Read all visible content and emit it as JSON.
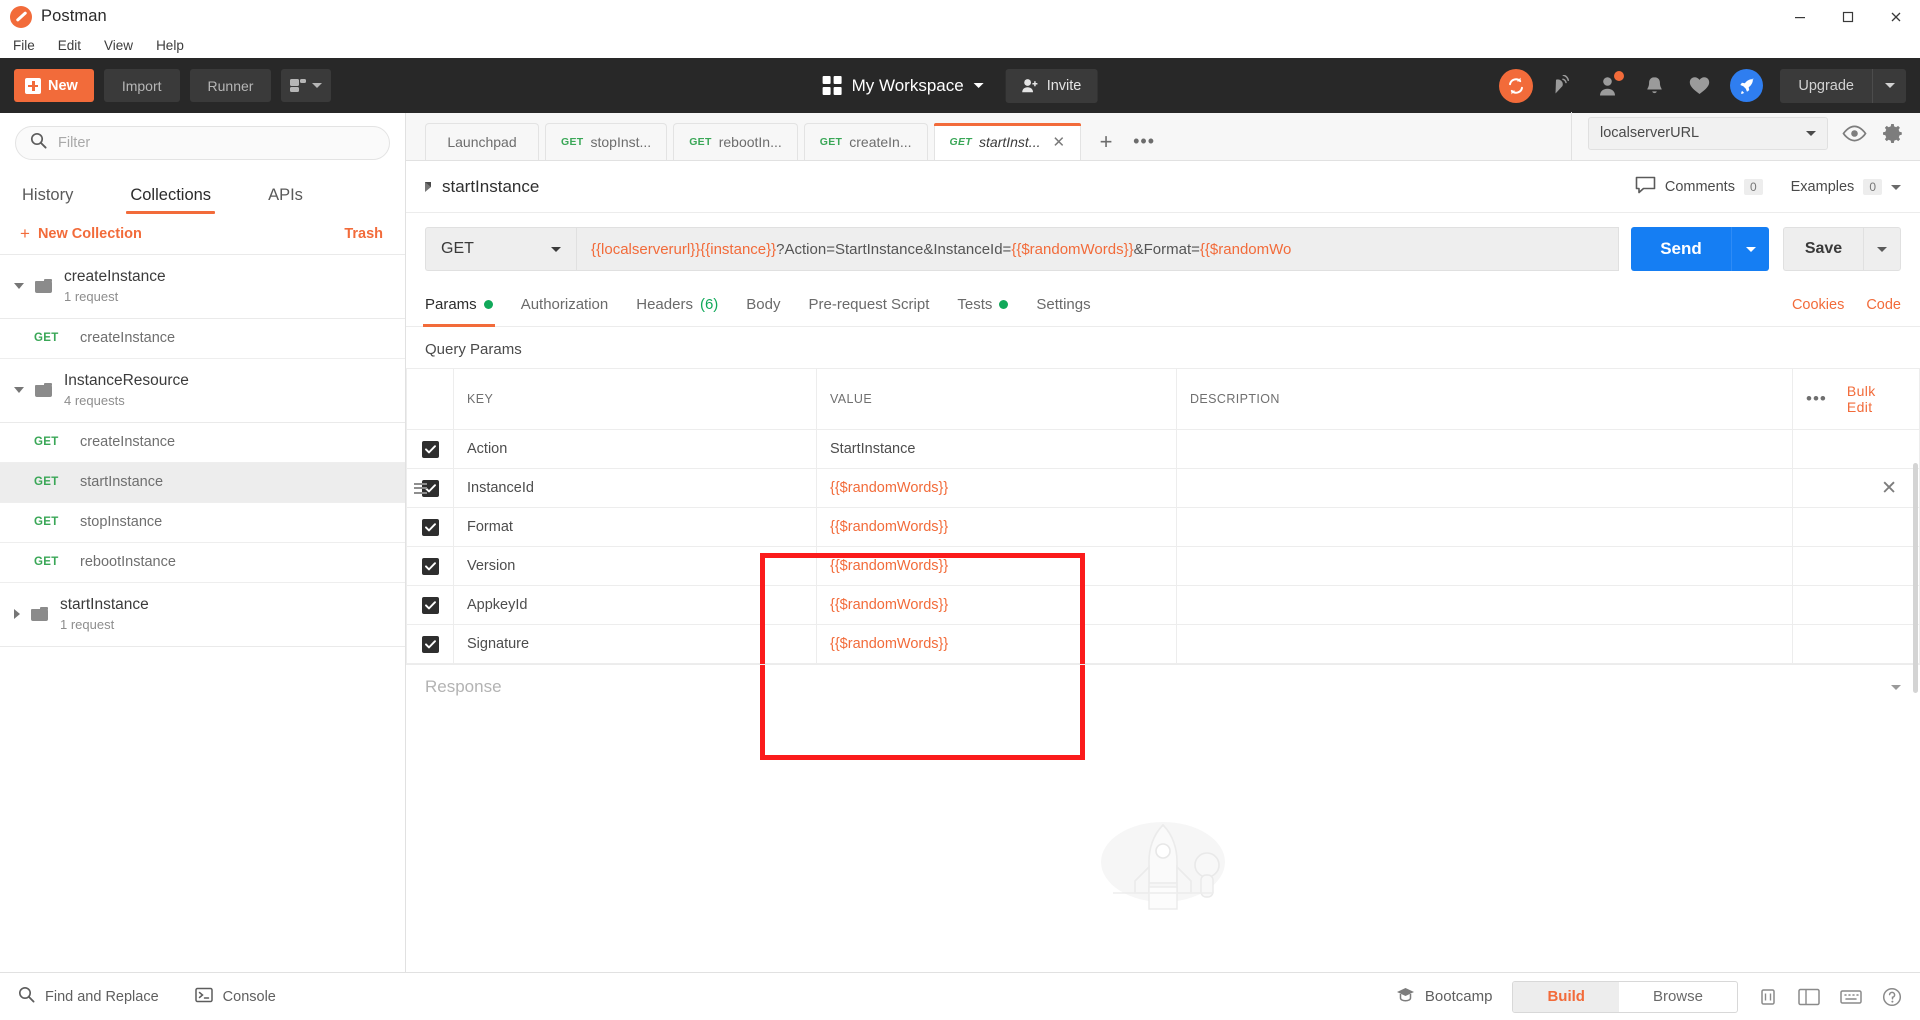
{
  "window": {
    "app_title": "Postman",
    "logo_icon": "postman-logo-icon",
    "minimize_icon": "minimize-icon",
    "maximize_icon": "maximize-icon",
    "close_icon": "close-icon"
  },
  "menubar": {
    "items": [
      "File",
      "Edit",
      "View",
      "Help"
    ]
  },
  "toolbar": {
    "new_label": "New",
    "import_label": "Import",
    "runner_label": "Runner",
    "capture_icon": "capture-requests-icon",
    "workspace_label": "My Workspace",
    "workspace_icon": "grid-icon",
    "invite_label": "Invite",
    "invite_icon": "person-add-icon",
    "icons": [
      "sync-icon",
      "satellite-icon",
      "account-icon",
      "notifications-bell-icon",
      "heart-icon",
      "rocket-icon"
    ],
    "upgrade_label": "Upgrade"
  },
  "sidebar": {
    "filter_placeholder": "Filter",
    "search_icon": "search-icon",
    "tabs": [
      {
        "label": "History",
        "active": false
      },
      {
        "label": "Collections",
        "active": true
      },
      {
        "label": "APIs",
        "active": false
      }
    ],
    "new_collection_label": "New Collection",
    "trash_label": "Trash",
    "tree": [
      {
        "type": "collection",
        "name": "createInstance",
        "sub": "1 request",
        "expanded": true
      },
      {
        "type": "request",
        "method": "GET",
        "name": "createInstance",
        "selected": false
      },
      {
        "type": "collection",
        "name": "InstanceResource",
        "sub": "4 requests",
        "expanded": true
      },
      {
        "type": "request",
        "method": "GET",
        "name": "createInstance",
        "selected": false
      },
      {
        "type": "request",
        "method": "GET",
        "name": "startInstance",
        "selected": true
      },
      {
        "type": "request",
        "method": "GET",
        "name": "stopInstance",
        "selected": false
      },
      {
        "type": "request",
        "method": "GET",
        "name": "rebootInstance",
        "selected": false
      },
      {
        "type": "collection",
        "name": "startInstance",
        "sub": "1 request",
        "expanded": false
      }
    ]
  },
  "tabstrip": {
    "tabs": [
      {
        "label": "Launchpad",
        "method": "",
        "active": false
      },
      {
        "label": "stopInst...",
        "method": "GET",
        "active": false
      },
      {
        "label": "rebootIn...",
        "method": "GET",
        "active": false
      },
      {
        "label": "createIn...",
        "method": "GET",
        "active": false
      },
      {
        "label": "startInst...",
        "method": "GET",
        "active": true
      }
    ],
    "add_tab_label": "+",
    "more_tabs_label": "•••",
    "environment": "localserverURL",
    "eye_icon": "eye-icon",
    "gear_icon": "gear-icon"
  },
  "request": {
    "name": "startInstance",
    "comments_label": "Comments",
    "comments_count": "0",
    "comments_icon": "comment-icon",
    "examples_label": "Examples",
    "examples_count": "0",
    "method": "GET",
    "url_prefix": "{{localserverurl}}{{instance}}",
    "url_middle": "?Action=StartInstance&InstanceId=",
    "url_var1": "{{$randomWords}}",
    "url_tail": "&Format=",
    "url_var2": "{{$randomWo",
    "send_label": "Send",
    "save_label": "Save",
    "subtabs": [
      {
        "label": "Params",
        "active": true,
        "dot": true
      },
      {
        "label": "Authorization",
        "active": false,
        "dot": false
      },
      {
        "label": "Headers",
        "active": false,
        "count": "(6)"
      },
      {
        "label": "Body",
        "active": false,
        "dot": false
      },
      {
        "label": "Pre-request Script",
        "active": false,
        "dot": false
      },
      {
        "label": "Tests",
        "active": false,
        "dot": true
      },
      {
        "label": "Settings",
        "active": false,
        "dot": false
      }
    ],
    "cookies_label": "Cookies",
    "code_label": "Code"
  },
  "params": {
    "section_label": "Query Params",
    "columns": [
      "KEY",
      "VALUE",
      "DESCRIPTION"
    ],
    "bulk_edit_label": "Bulk Edit",
    "more_icon": "more-horizontal-icon",
    "rows": [
      {
        "checked": true,
        "key": "Action",
        "value": "StartInstance",
        "is_var": false,
        "description": "",
        "drag": false,
        "remove": false
      },
      {
        "checked": true,
        "key": "InstanceId",
        "value": "{{$randomWords}}",
        "is_var": true,
        "description": "",
        "drag": true,
        "remove": true
      },
      {
        "checked": true,
        "key": "Format",
        "value": "{{$randomWords}}",
        "is_var": true,
        "description": "",
        "drag": false,
        "remove": false
      },
      {
        "checked": true,
        "key": "Version",
        "value": "{{$randomWords}}",
        "is_var": true,
        "description": "",
        "drag": false,
        "remove": false
      },
      {
        "checked": true,
        "key": "AppkeyId",
        "value": "{{$randomWords}}",
        "is_var": true,
        "description": "",
        "drag": false,
        "remove": false
      },
      {
        "checked": true,
        "key": "Signature",
        "value": "{{$randomWords}}",
        "is_var": true,
        "description": "",
        "drag": false,
        "remove": false
      }
    ]
  },
  "response": {
    "label": "Response",
    "rocket_icon": "rocket-illustration"
  },
  "statusbar": {
    "find_replace_label": "Find and Replace",
    "find_icon": "search-icon",
    "console_label": "Console",
    "console_icon": "terminal-icon",
    "bootcamp_label": "Bootcamp",
    "bootcamp_icon": "bootcamp-icon",
    "build_label": "Build",
    "browse_label": "Browse",
    "util_icons": [
      "trash-icon",
      "layout-icon",
      "keyboard-icon",
      "help-icon"
    ]
  },
  "annotation": {
    "highlight_color": "#fb1b1b"
  }
}
